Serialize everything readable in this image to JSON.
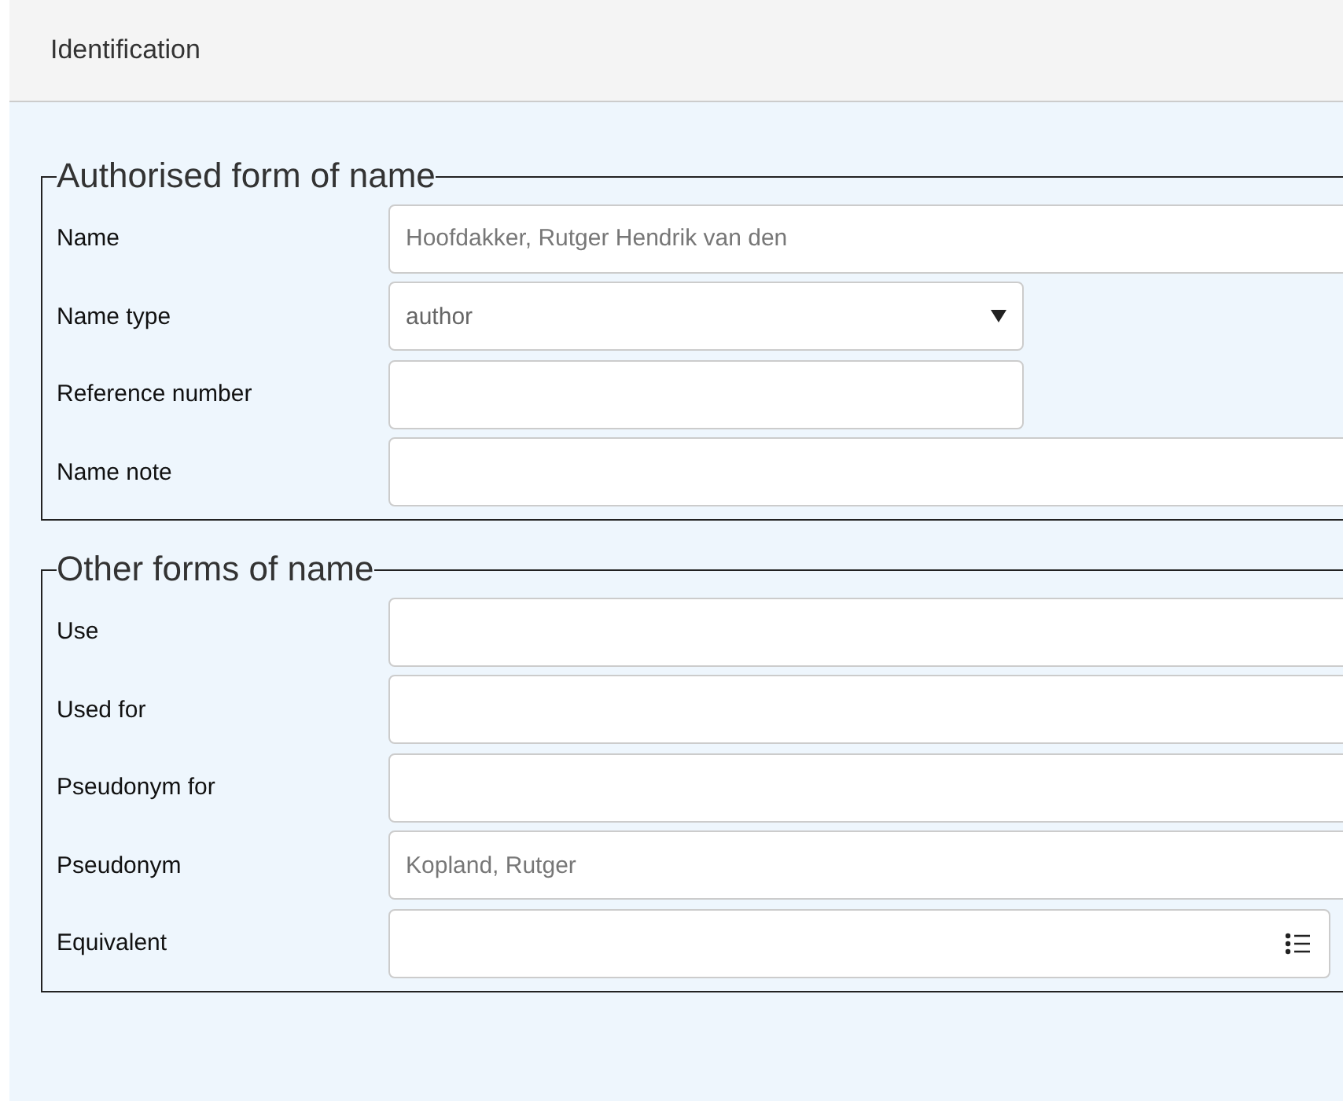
{
  "header": {
    "title": "Identification"
  },
  "sections": [
    {
      "legend": "Authorised form of name",
      "fields": [
        {
          "label": "Name",
          "kind": "text",
          "value": "Hoofdakker, Rutger Hendrik van den"
        },
        {
          "label": "Name type",
          "kind": "select",
          "value": "author"
        },
        {
          "label": "Reference number",
          "kind": "short-text"
        },
        {
          "label": "Name note",
          "kind": "text"
        }
      ]
    },
    {
      "legend": "Other forms of name",
      "fields": [
        {
          "label": "Use",
          "kind": "text"
        },
        {
          "label": "Used for",
          "kind": "text"
        },
        {
          "label": "Pseudonym for",
          "kind": "text"
        },
        {
          "label": "Pseudonym",
          "kind": "text",
          "value": "Kopland, Rutger"
        },
        {
          "label": "Equivalent",
          "kind": "lookup"
        }
      ]
    }
  ]
}
